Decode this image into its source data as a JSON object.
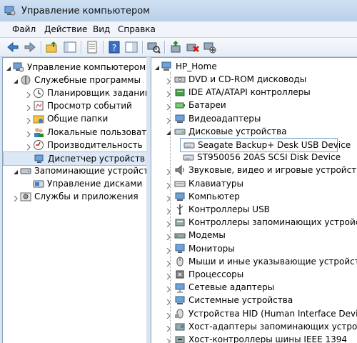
{
  "window": {
    "title": "Управление компьютером"
  },
  "menu": [
    "Файл",
    "Действие",
    "Вид",
    "Справка"
  ],
  "left_tree": [
    {
      "label": "Управление компьютером (л",
      "icon": "computer-management-icon",
      "expanded": true
    },
    {
      "label": "Служебные программы",
      "icon": "tools-icon",
      "expanded": true
    },
    {
      "label": "Планировщик заданий",
      "icon": "clock-icon"
    },
    {
      "label": "Просмотр событий",
      "icon": "event-viewer-icon"
    },
    {
      "label": "Общие папки",
      "icon": "shared-folder-icon"
    },
    {
      "label": "Локальные пользовате",
      "icon": "users-icon"
    },
    {
      "label": "Производительность",
      "icon": "performance-icon"
    },
    {
      "label": "Диспетчер устройств",
      "icon": "device-manager-icon",
      "selected": true
    },
    {
      "label": "Запоминающие устройст",
      "icon": "storage-icon",
      "expanded": true
    },
    {
      "label": "Управление дисками",
      "icon": "disk-management-icon"
    },
    {
      "label": "Службы и приложения",
      "icon": "services-icon",
      "expanded": false
    }
  ],
  "right_tree": {
    "root": "HP_Home",
    "items": [
      {
        "label": "DVD и CD-ROM дисководы",
        "icon": "dvd-drive-icon"
      },
      {
        "label": "IDE ATA/ATAPI контроллеры",
        "icon": "ide-controller-icon"
      },
      {
        "label": "Батареи",
        "icon": "battery-icon"
      },
      {
        "label": "Видеоадаптеры",
        "icon": "display-adapter-icon"
      },
      {
        "label": "Дисковые устройства",
        "icon": "disk-drive-icon",
        "expanded": true
      },
      {
        "label": "Seagate Backup+ Desk USB Device",
        "icon": "hard-disk-icon",
        "child": true,
        "selected": true
      },
      {
        "label": "ST950056 20AS SCSI Disk Device",
        "icon": "hard-disk-icon",
        "child": true
      },
      {
        "label": "Звуковые, видео и игровые устройства",
        "icon": "sound-icon"
      },
      {
        "label": "Клавиатуры",
        "icon": "keyboard-icon"
      },
      {
        "label": "Компьютер",
        "icon": "computer-icon"
      },
      {
        "label": "Контроллеры USB",
        "icon": "usb-icon"
      },
      {
        "label": "Контроллеры запоминающих устройств",
        "icon": "storage-controller-icon"
      },
      {
        "label": "Модемы",
        "icon": "modem-icon"
      },
      {
        "label": "Мониторы",
        "icon": "monitor-icon"
      },
      {
        "label": "Мыши и иные указывающие устройства",
        "icon": "mouse-icon"
      },
      {
        "label": "Процессоры",
        "icon": "processor-icon"
      },
      {
        "label": "Сетевые адаптеры",
        "icon": "network-adapter-icon"
      },
      {
        "label": "Системные устройства",
        "icon": "system-device-icon"
      },
      {
        "label": "Устройства HID (Human Interface Devices)",
        "icon": "hid-icon"
      },
      {
        "label": "Хост-адаптеры запоминающих устройств",
        "icon": "host-adapter-icon"
      },
      {
        "label": "Хост-контроллеры шины IEEE 1394",
        "icon": "ieee1394-icon"
      }
    ]
  },
  "toolbar": [
    "back-icon",
    "forward-icon",
    "up-folder-icon",
    "show-tree-icon",
    "properties-icon",
    "help-icon",
    "console-tree-icon",
    "scan-hardware-icon",
    "update-driver-icon",
    "uninstall-device-icon",
    "disable-device-icon"
  ]
}
